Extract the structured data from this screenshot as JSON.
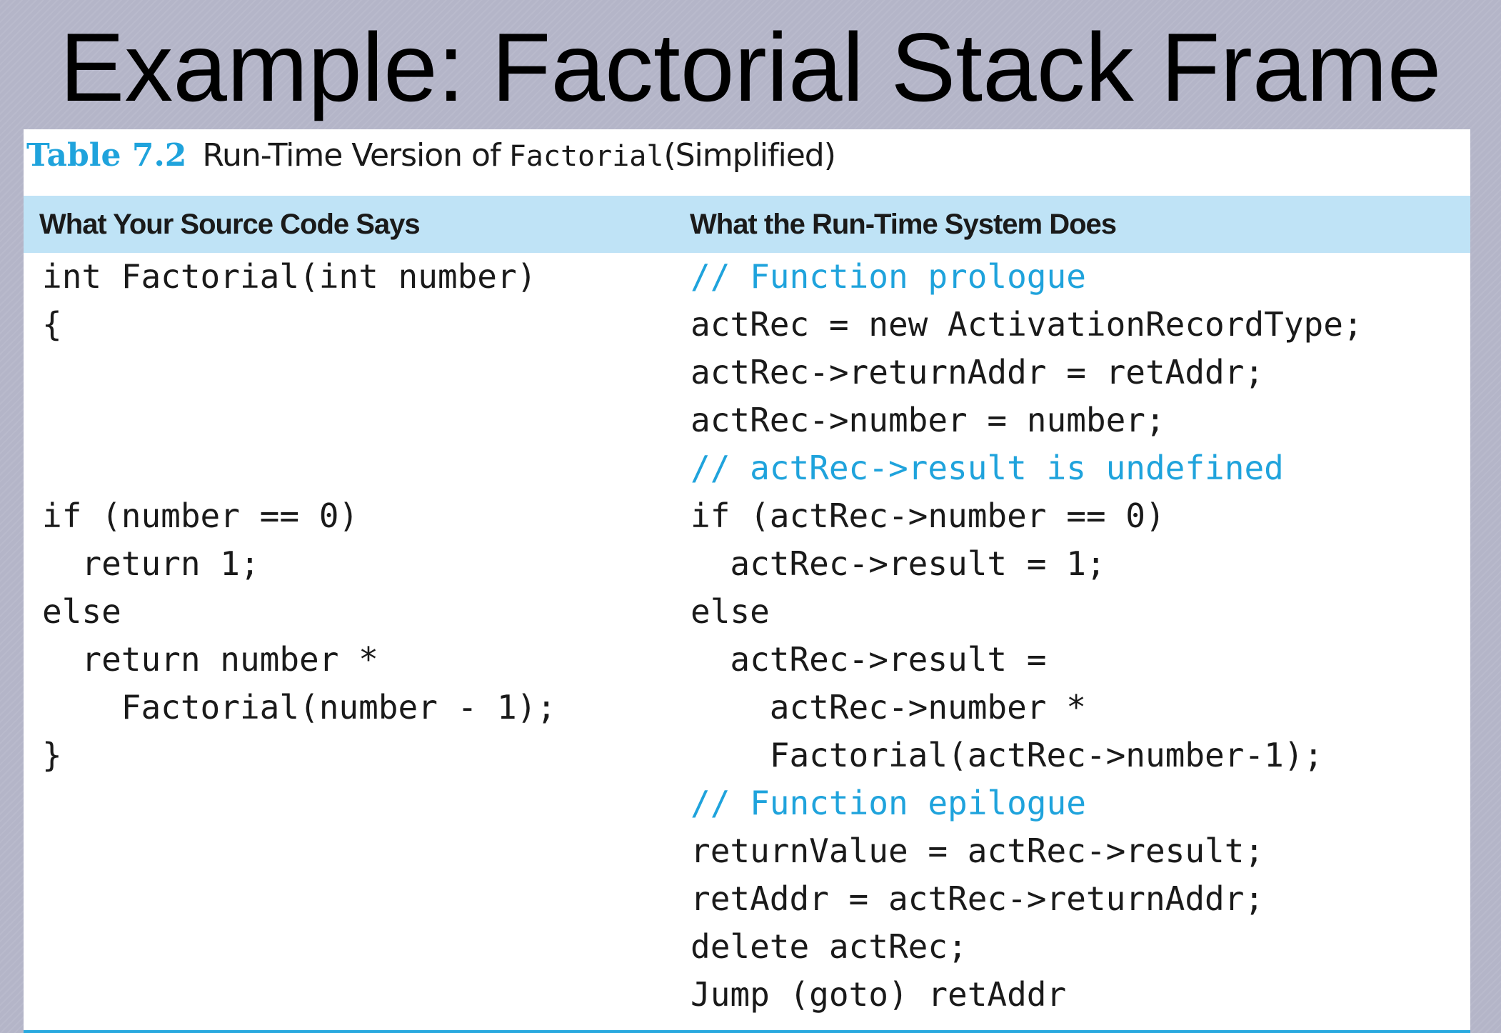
{
  "slide": {
    "title": "Example: Factorial Stack Frame"
  },
  "table": {
    "caption_number": "Table 7.2",
    "caption_text": "Run-Time Version of",
    "caption_code": "Factorial",
    "caption_suffix": "(Simplified)",
    "headers": [
      "What Your Source Code Says",
      "What the Run-Time System Does"
    ],
    "colors": {
      "accent": "#1fa3dc",
      "header_bg": "#bfe3f6",
      "slide_bg": "#b4b5c8"
    },
    "source_lines": [
      {
        "text": "int Factorial(int number)",
        "comment": false
      },
      {
        "text": "{",
        "comment": false
      },
      {
        "text": "",
        "comment": false
      },
      {
        "text": "",
        "comment": false
      },
      {
        "text": "",
        "comment": false
      },
      {
        "text": "if (number == 0)",
        "comment": false
      },
      {
        "text": "  return 1;",
        "comment": false
      },
      {
        "text": "else",
        "comment": false
      },
      {
        "text": "  return number *",
        "comment": false
      },
      {
        "text": "    Factorial(number - 1);",
        "comment": false
      },
      {
        "text": "}",
        "comment": false
      }
    ],
    "runtime_lines": [
      {
        "text": "// Function prologue",
        "comment": true
      },
      {
        "text": "actRec = new ActivationRecordType;",
        "comment": false
      },
      {
        "text": "actRec->returnAddr = retAddr;",
        "comment": false
      },
      {
        "text": "actRec->number = number;",
        "comment": false
      },
      {
        "text": "// actRec->result is undefined",
        "comment": true
      },
      {
        "text": "if (actRec->number == 0)",
        "comment": false
      },
      {
        "text": "  actRec->result = 1;",
        "comment": false
      },
      {
        "text": "else",
        "comment": false
      },
      {
        "text": "  actRec->result =",
        "comment": false
      },
      {
        "text": "    actRec->number *",
        "comment": false
      },
      {
        "text": "    Factorial(actRec->number-1);",
        "comment": false
      },
      {
        "text": "// Function epilogue",
        "comment": true
      },
      {
        "text": "returnValue = actRec->result;",
        "comment": false
      },
      {
        "text": "retAddr = actRec->returnAddr;",
        "comment": false
      },
      {
        "text": "delete actRec;",
        "comment": false
      },
      {
        "text": "Jump (goto) retAddr",
        "comment": false
      }
    ]
  }
}
